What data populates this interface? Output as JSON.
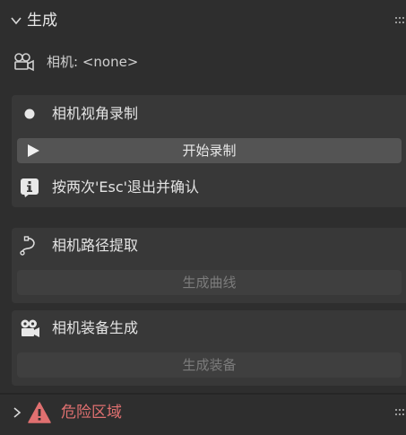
{
  "panel": {
    "title": "生成",
    "camera_label": "相机: <none>"
  },
  "sections": {
    "recording": {
      "title": "相机视角录制",
      "button_label": "开始录制",
      "info_text": "按两次'Esc'退出并确认"
    },
    "path": {
      "title": "相机路径提取",
      "button_label": "生成曲线"
    },
    "rig": {
      "title": "相机装备生成",
      "button_label": "生成装备"
    }
  },
  "danger": {
    "title": "危险区域"
  },
  "colors": {
    "background": "#2e2e2e",
    "box": "#383838",
    "button": "#545454",
    "button_disabled": "#3f3f3f",
    "danger": "#e07070"
  }
}
